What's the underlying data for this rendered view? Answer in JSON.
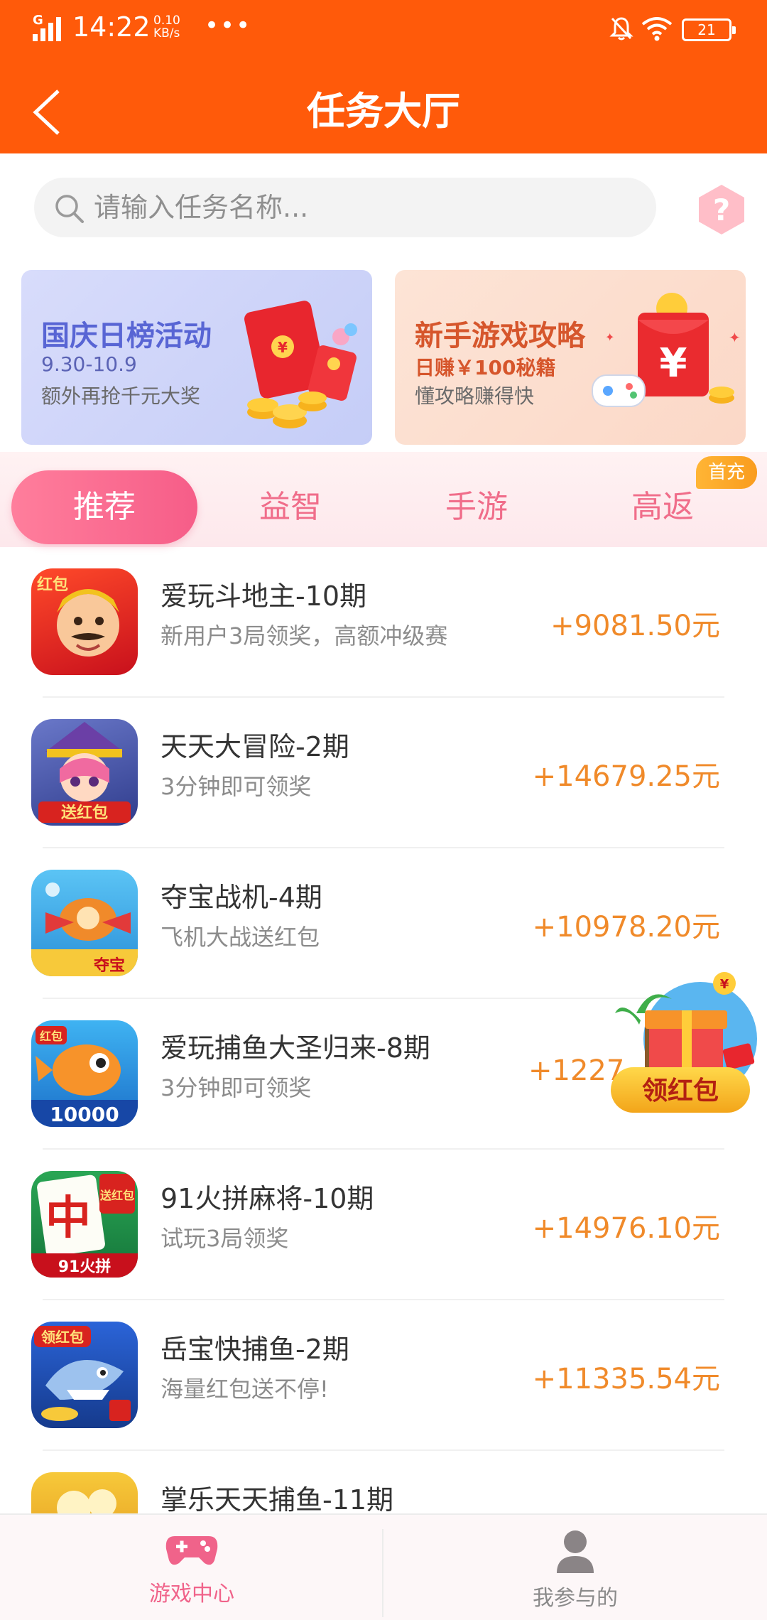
{
  "status_bar": {
    "time": "14:22",
    "net_speed_value": "0.10",
    "net_speed_unit": "KB/s",
    "network": "G",
    "battery": "21"
  },
  "header": {
    "title": "任务大厅"
  },
  "search": {
    "placeholder": "请输入任务名称..."
  },
  "banners": [
    {
      "title": "国庆日榜活动",
      "line2": "9.30-10.9",
      "line3": "额外再抢千元大奖"
    },
    {
      "title": "新手游戏攻略",
      "line2": "日赚￥100秘籍",
      "line3": "懂攻略赚得快"
    }
  ],
  "tabs": [
    "推荐",
    "益智",
    "手游",
    "高返"
  ],
  "tab_badge": "首充",
  "tasks": [
    {
      "name": "爱玩斗地主-10期",
      "desc": "新用户3局领奖，高额冲级赛",
      "reward": "+9081.50元",
      "icon_label": "红包"
    },
    {
      "name": "天天大冒险-2期",
      "desc": "3分钟即可领奖",
      "reward": "+14679.25元",
      "icon_label": "送红包"
    },
    {
      "name": "夺宝战机-4期",
      "desc": "飞机大战送红包",
      "reward": "+10978.20元",
      "icon_label": "夺宝"
    },
    {
      "name": "爱玩捕鱼大圣归来-8期",
      "desc": "3分钟即可领奖",
      "reward": "+1227",
      "icon_label": "10000"
    },
    {
      "name": "91火拼麻将-10期",
      "desc": "试玩3局领奖",
      "reward": "+14976.10元",
      "icon_label": "91火拼"
    },
    {
      "name": "岳宝快捕鱼-2期",
      "desc": "海量红包送不停!",
      "reward": "+11335.54元",
      "icon_label": "领红包"
    },
    {
      "name": "掌乐天天捕鱼-11期",
      "desc": "",
      "reward": "",
      "icon_label": ""
    }
  ],
  "floating": {
    "label": "领红包"
  },
  "bottom_nav": [
    {
      "label": "游戏中心",
      "icon": "gamepad-icon",
      "active": true
    },
    {
      "label": "我参与的",
      "icon": "user-icon",
      "active": false
    }
  ],
  "colors": {
    "primary": "#ff5a0a",
    "tab_active": "#f65d88",
    "reward": "#f08a2a"
  }
}
